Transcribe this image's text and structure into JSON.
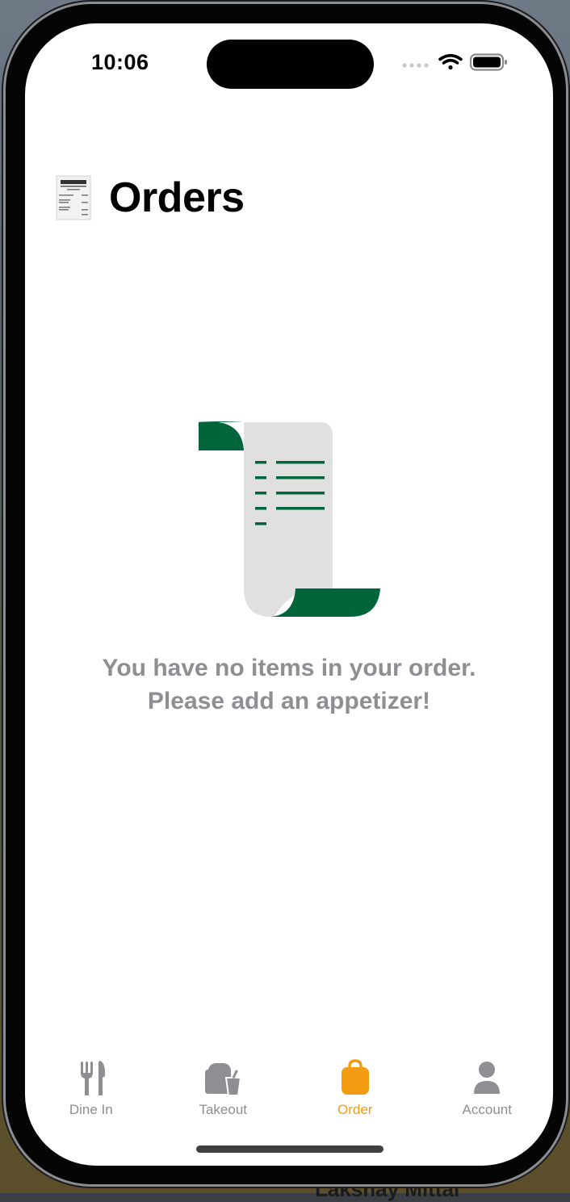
{
  "status_bar": {
    "time": "10:06",
    "icons": [
      "cellular-signal-icon",
      "wifi-icon",
      "battery-icon"
    ]
  },
  "header": {
    "icon": "receipt-icon",
    "title": "Orders"
  },
  "empty_state": {
    "illustration": "receipt-scroll-icon",
    "line1": "You have no items in your order.",
    "line2": "Please add an appetizer!"
  },
  "tab_bar": {
    "items": [
      {
        "label": "Dine In",
        "icon": "fork-knife-icon",
        "active": false
      },
      {
        "label": "Takeout",
        "icon": "takeout-bag-icon",
        "active": false
      },
      {
        "label": "Order",
        "icon": "bag-icon",
        "active": true
      },
      {
        "label": "Account",
        "icon": "person-icon",
        "active": false
      }
    ]
  },
  "background": {
    "partial_text": "Lakshay Mittal"
  },
  "colors": {
    "accent": "#f39c12",
    "inactive": "#8e8e93",
    "illustration_green": "#00653a",
    "illustration_paper": "#e0e0e0"
  }
}
